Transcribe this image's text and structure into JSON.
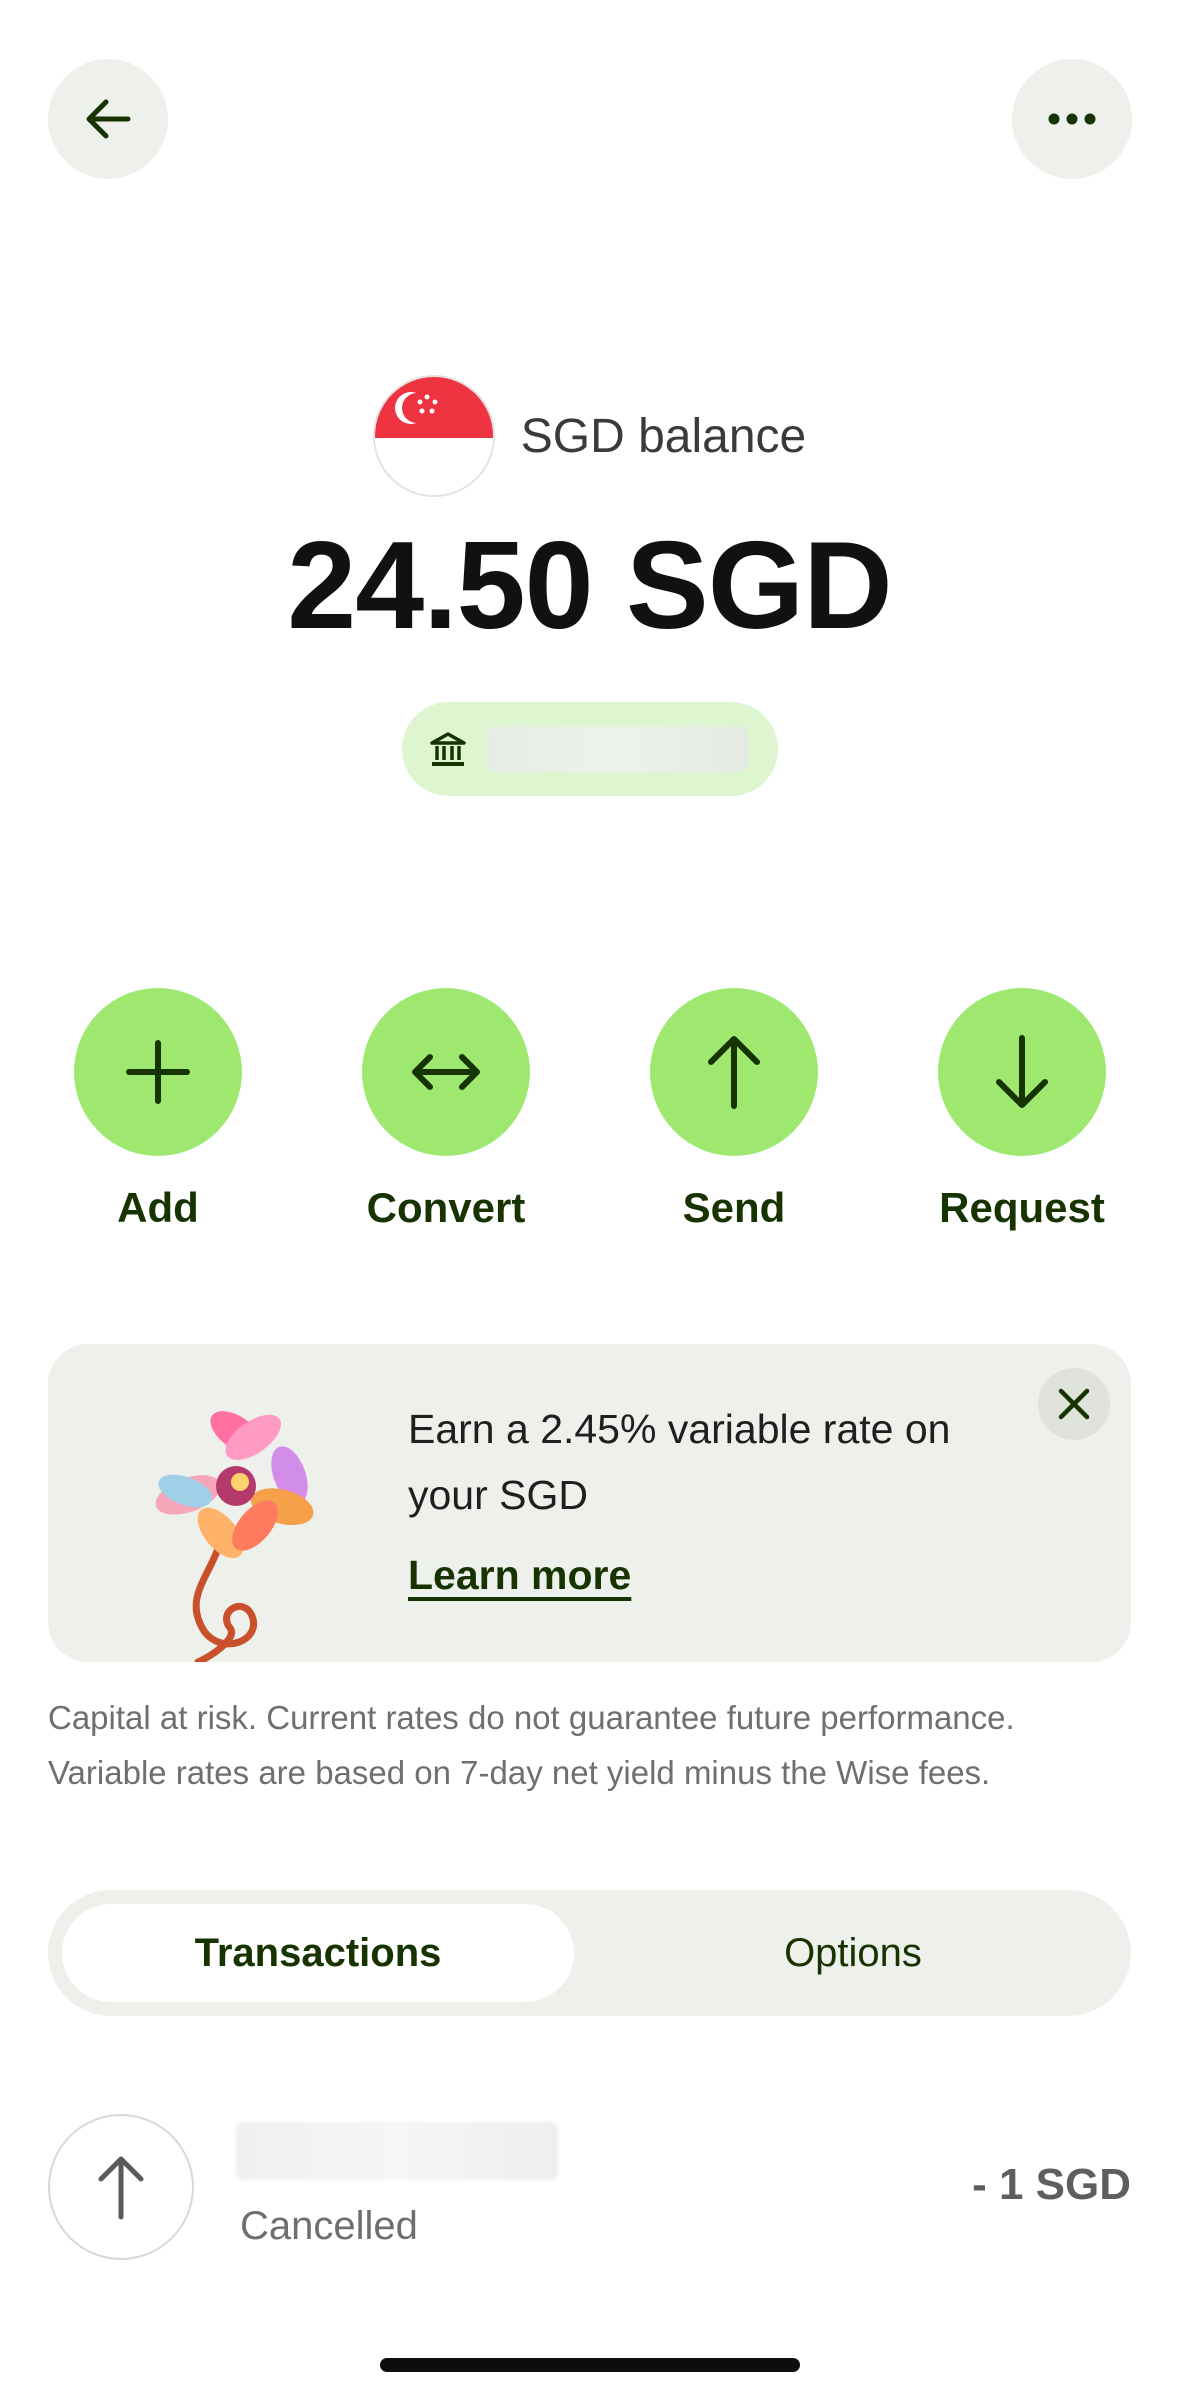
{
  "header": {
    "back_icon": "arrow-left-icon",
    "more_icon": "more-horizontal-icon"
  },
  "balance": {
    "flag_icon": "singapore-flag-icon",
    "label": "SGD balance",
    "amount": "24.50 SGD",
    "account_icon": "bank-icon"
  },
  "actions": [
    {
      "label": "Add",
      "icon": "plus-icon"
    },
    {
      "label": "Convert",
      "icon": "convert-arrows-icon"
    },
    {
      "label": "Send",
      "icon": "arrow-up-icon"
    },
    {
      "label": "Request",
      "icon": "arrow-down-icon"
    }
  ],
  "promo": {
    "text": "Earn a 2.45% variable rate on your SGD",
    "link": "Learn more",
    "close_icon": "close-icon",
    "illustration": "flower-illustration"
  },
  "disclaimer": {
    "line1": "Capital at risk. Current rates do not guarantee future performance.",
    "line2": "Variable rates are based on 7-day net yield minus the Wise fees."
  },
  "tabs": [
    {
      "label": "Transactions",
      "active": true
    },
    {
      "label": "Options",
      "active": false
    }
  ],
  "transactions": [
    {
      "status": "Cancelled",
      "amount": "- 1 SGD",
      "icon": "arrow-up-icon"
    }
  ],
  "colors": {
    "accent_green": "#9fe870",
    "dark_green": "#163300",
    "pill_green": "#ddf6cf",
    "surface_gray": "#eef0ec"
  }
}
